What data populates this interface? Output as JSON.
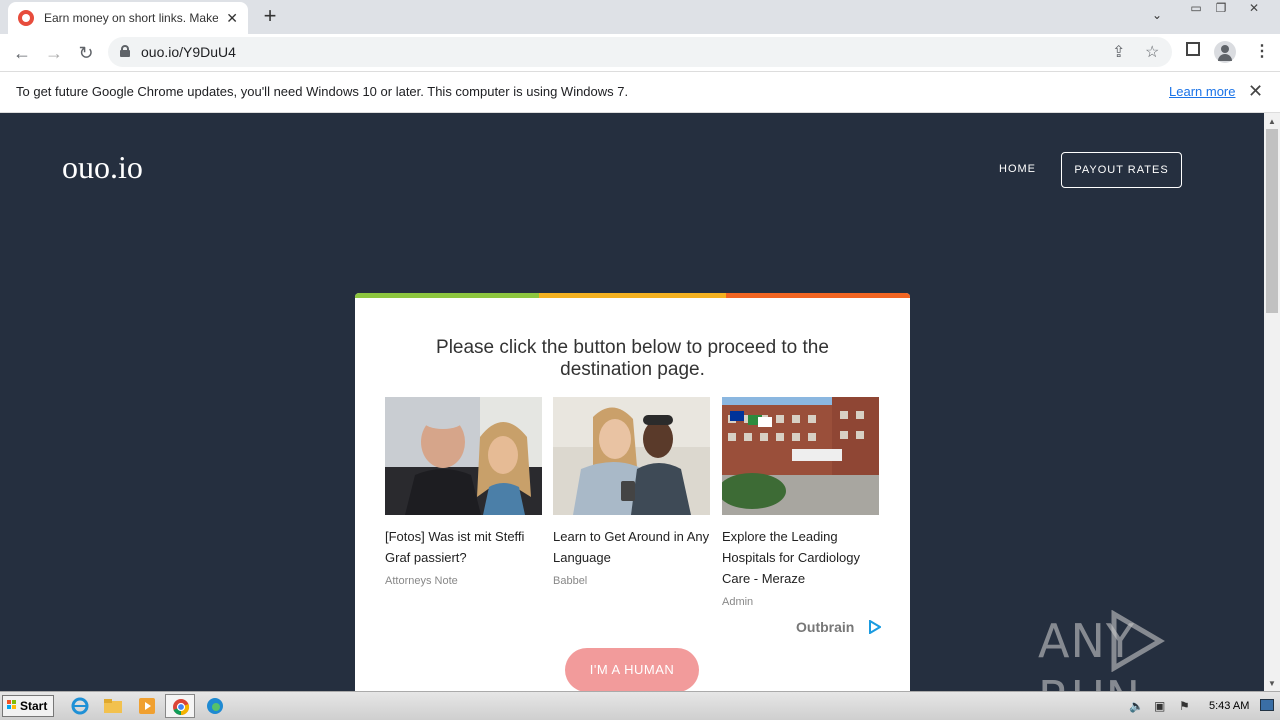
{
  "browser": {
    "tab_title": "Earn money on short links. Make sho",
    "tab_close": "✕",
    "new_tab": "+",
    "url": "ouo.io/Y9DuU4",
    "infobar_text": "To get future Google Chrome updates, you'll need Windows 10 or later. This computer is using Windows 7.",
    "learn_more": "Learn more"
  },
  "site": {
    "logo": "ouo.io",
    "nav": {
      "home": "HOME",
      "payout": "PAYOUT RATES"
    },
    "heading": "Please click the button below to proceed to the destination page.",
    "human_button": "I'M A HUMAN",
    "outbrain": "Outbrain"
  },
  "ads": [
    {
      "title": "[Fotos] Was ist mit Steffi Graf passiert?",
      "source": "Attorneys Note"
    },
    {
      "title": "Learn to Get Around in Any Language",
      "source": "Babbel"
    },
    {
      "title": "Explore the Leading Hospitals for Cardiology Care - Meraze",
      "source": "Admin"
    }
  ],
  "watermark": {
    "left": "ANY",
    "right": "RUN"
  },
  "taskbar": {
    "start": "Start",
    "clock": "5:43 AM"
  },
  "colors": {
    "page_bg": "#252f3f",
    "bar_green": "#8dc63f",
    "bar_yellow": "#f4b120",
    "bar_orange": "#f26522",
    "human_btn": "#f29b9b"
  }
}
